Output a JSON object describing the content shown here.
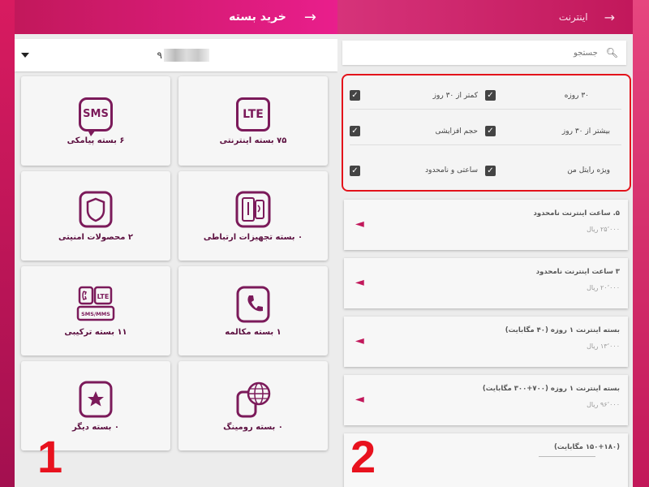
{
  "panel1": {
    "header": {
      "title": "خرید بسته",
      "back_icon": "→"
    },
    "phone": {
      "prefix": "۹",
      "dropdown_icon": "caret-down"
    },
    "cards": [
      {
        "label": "۶ بسته پیامکی",
        "icon": "SMS"
      },
      {
        "label": "۷۵ بسته اینترنتی",
        "icon": "LTE"
      },
      {
        "label": "۲ محصولات امنیتی",
        "icon": "shield"
      },
      {
        "label": "۰ بسته تجهیزات ارتباطی",
        "icon": "usb-device"
      },
      {
        "label": "۱۱ بسته ترکیبی",
        "icon": "LTE",
        "sub_icon": "SMS/MMS"
      },
      {
        "label": "۱ بسته مکالمه",
        "icon": "phone"
      },
      {
        "label": "۰ بسته دیگر",
        "icon": "star"
      },
      {
        "label": "۰ بسته رومینگ",
        "icon": "globe-phone"
      }
    ],
    "marker": "1"
  },
  "panel2": {
    "header": {
      "title": "اینترنت",
      "back_icon": "→"
    },
    "search": {
      "placeholder": "جستجو"
    },
    "filters": [
      {
        "label": "۳۰ روزه",
        "checked": true
      },
      {
        "label": "کمتر از ۳۰ روز",
        "checked": true
      },
      {
        "label": "بیشتر از ۳۰ روز",
        "checked": true
      },
      {
        "label": "حجم افزایشی",
        "checked": true
      },
      {
        "label": "ویژه رایتل من",
        "checked": true
      },
      {
        "label": "ساعتی و نامحدود",
        "checked": true
      }
    ],
    "packages": [
      {
        "name": "۵. ساعت اینترنت نامحدود",
        "price": "۲۵٬۰۰۰ ریال"
      },
      {
        "name": "۳ ساعت اینترنت نامحدود",
        "price": "۲۰٬۰۰۰ ریال"
      },
      {
        "name": "بسته اینترنت ۱ روزه (۴۰ مگابایت)",
        "price": "۱۳٬۰۰۰ ریال"
      },
      {
        "name": "بسته اینترنت ۱ روزه (۷۰۰+۳۰۰ مگابایت)",
        "price": "۹۶٬۰۰۰ ریال"
      },
      {
        "name": "(۱۵۰+۱۸۰ مگابایت)",
        "price": ""
      }
    ],
    "marker": "2"
  },
  "colors": {
    "brand": "#c2185b",
    "icon": "#7b1a5a",
    "highlight": "#e3131b"
  }
}
